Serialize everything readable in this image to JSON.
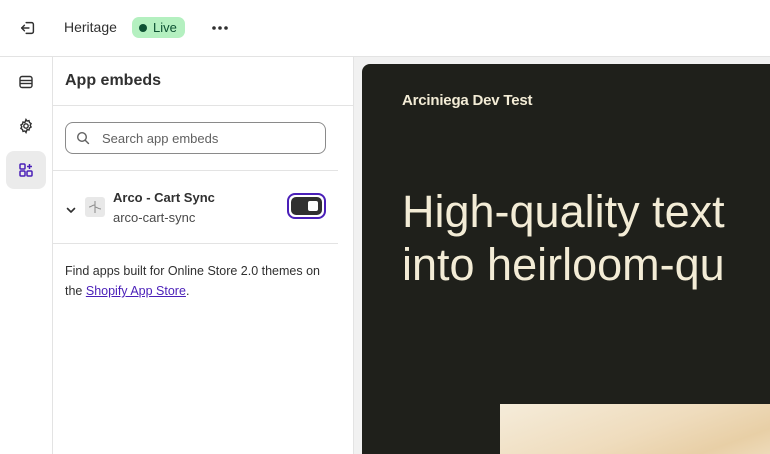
{
  "topbar": {
    "theme_name": "Heritage",
    "status_badge": "Live"
  },
  "icons": {
    "exit": "exit-icon",
    "more": "more-horizontal-icon",
    "sections": "sections-icon",
    "settings": "gear-icon",
    "app_embeds": "app-blocks-icon",
    "search": "search-icon",
    "chevron": "chevron-down-icon"
  },
  "panel": {
    "title": "App embeds",
    "search_placeholder": "Search app embeds",
    "embeds": [
      {
        "name": "Arco - Cart Sync",
        "handle": "arco-cart-sync",
        "enabled": true
      }
    ],
    "help_text": "Find apps built for Online Store 2.0 themes on the ",
    "help_link": "Shopify App Store",
    "help_suffix": "."
  },
  "preview": {
    "store_name": "Arciniega Dev Test",
    "hero_line1": "High-quality text",
    "hero_line2": "into heirloom-qu"
  },
  "colors": {
    "live_badge_bg": "#b4f0c0",
    "toggle_focus": "#4a1fb8",
    "preview_bg": "#1f201b",
    "preview_text": "#f3ecd6"
  }
}
